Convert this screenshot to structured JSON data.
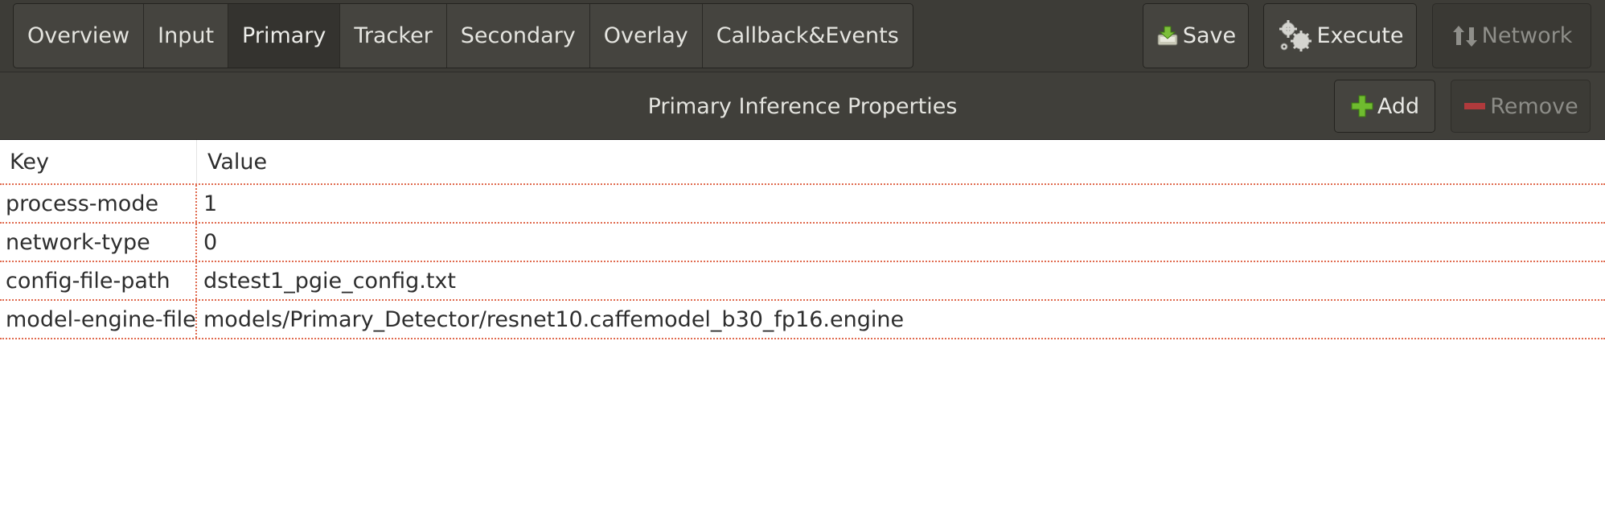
{
  "toolbar": {
    "tabs": [
      {
        "label": "Overview"
      },
      {
        "label": "Input"
      },
      {
        "label": "Primary"
      },
      {
        "label": "Tracker"
      },
      {
        "label": "Secondary"
      },
      {
        "label": "Overlay"
      },
      {
        "label": "Callback&Events"
      }
    ],
    "active_tab": "Primary",
    "save_label": "Save",
    "execute_label": "Execute",
    "network_label": "Network"
  },
  "header": {
    "title": "Primary Inference Properties",
    "add_label": "Add",
    "remove_label": "Remove"
  },
  "table": {
    "columns": [
      "Key",
      "Value"
    ],
    "rows": [
      {
        "key": "process-mode",
        "value": "1"
      },
      {
        "key": "network-type",
        "value": "0"
      },
      {
        "key": "config-file-path",
        "value": "dstest1_pgie_config.txt"
      },
      {
        "key": "model-engine-file",
        "value": "models/Primary_Detector/resnet10.caffemodel_b30_fp16.engine"
      }
    ]
  },
  "colors": {
    "toolbar_bg": "#3d3c37",
    "add_icon": "#5fae2e",
    "remove_icon": "#b5383a",
    "grid_line": "#e06a4e"
  },
  "icons": {
    "save": "save-icon",
    "execute": "gears-icon",
    "network": "up-down-arrows-icon",
    "add": "plus-icon",
    "remove": "minus-icon"
  }
}
